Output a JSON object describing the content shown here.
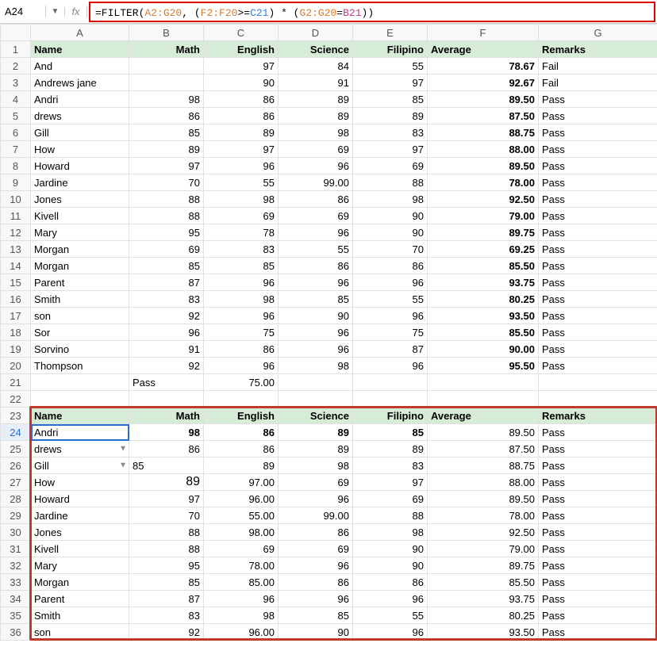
{
  "cellRef": "A24",
  "fx": "fx",
  "formula_parts": {
    "p1": "=FILTER(",
    "range": "A2:G20",
    "p2": ", (",
    "f_range": "F2:F20",
    "p3": ">=",
    "c21": "C21",
    "p4": ") * (",
    "g_range": "G2:G20",
    "p5": "=",
    "b21": "B21",
    "p6": "))"
  },
  "colHeaders": [
    "A",
    "B",
    "C",
    "D",
    "E",
    "F",
    "G"
  ],
  "rowNums": [
    "1",
    "2",
    "3",
    "4",
    "5",
    "6",
    "7",
    "8",
    "9",
    "10",
    "11",
    "12",
    "13",
    "14",
    "15",
    "16",
    "17",
    "18",
    "19",
    "20",
    "21",
    "22",
    "23",
    "24",
    "25",
    "26",
    "27",
    "28",
    "29",
    "30",
    "31",
    "32",
    "33",
    "34",
    "35",
    "36"
  ],
  "headers": {
    "name": "Name",
    "math": "Math",
    "english": "English",
    "science": "Science",
    "filipino": "Filipino",
    "average": "Average",
    "remarks": "Remarks"
  },
  "topRows": [
    {
      "name": "And",
      "math": "",
      "english": "97",
      "science": "84",
      "filipino": "55",
      "avg": "78.67",
      "rem": "Fail"
    },
    {
      "name": "Andrews jane",
      "math": "",
      "english": "90",
      "science": "91",
      "filipino": "97",
      "avg": "92.67",
      "rem": "Fail"
    },
    {
      "name": "Andri",
      "math": "98",
      "english": "86",
      "science": "89",
      "filipino": "85",
      "avg": "89.50",
      "rem": "Pass"
    },
    {
      "name": "drews",
      "math": "86",
      "english": "86",
      "science": "89",
      "filipino": "89",
      "avg": "87.50",
      "rem": "Pass"
    },
    {
      "name": "Gill",
      "math": "85",
      "english": "89",
      "science": "98",
      "filipino": "83",
      "avg": "88.75",
      "rem": "Pass"
    },
    {
      "name": "How",
      "math": "89",
      "english": "97",
      "science": "69",
      "filipino": "97",
      "avg": "88.00",
      "rem": "Pass"
    },
    {
      "name": "Howard",
      "math": "97",
      "english": "96",
      "science": "96",
      "filipino": "69",
      "avg": "89.50",
      "rem": "Pass"
    },
    {
      "name": "Jardine",
      "math": "70",
      "english": "55",
      "science": "99.00",
      "filipino": "88",
      "avg": "78.00",
      "rem": "Pass"
    },
    {
      "name": "Jones",
      "math": "88",
      "english": "98",
      "science": "86",
      "filipino": "98",
      "avg": "92.50",
      "rem": "Pass"
    },
    {
      "name": "Kivell",
      "math": "88",
      "english": "69",
      "science": "69",
      "filipino": "90",
      "avg": "79.00",
      "rem": "Pass"
    },
    {
      "name": "Mary",
      "math": "95",
      "english": "78",
      "science": "96",
      "filipino": "90",
      "avg": "89.75",
      "rem": "Pass"
    },
    {
      "name": "Morgan",
      "math": "69",
      "english": "83",
      "science": "55",
      "filipino": "70",
      "avg": "69.25",
      "rem": "Pass"
    },
    {
      "name": "Morgan",
      "math": "85",
      "english": "85",
      "science": "86",
      "filipino": "86",
      "avg": "85.50",
      "rem": "Pass"
    },
    {
      "name": "Parent",
      "math": "87",
      "english": "96",
      "science": "96",
      "filipino": "96",
      "avg": "93.75",
      "rem": "Pass"
    },
    {
      "name": "Smith",
      "math": "83",
      "english": "98",
      "science": "85",
      "filipino": "55",
      "avg": "80.25",
      "rem": "Pass"
    },
    {
      "name": "son",
      "math": "92",
      "english": "96",
      "science": "90",
      "filipino": "96",
      "avg": "93.50",
      "rem": "Pass"
    },
    {
      "name": "Sor",
      "math": "96",
      "english": "75",
      "science": "96",
      "filipino": "75",
      "avg": "85.50",
      "rem": "Pass"
    },
    {
      "name": "Sorvino",
      "math": "91",
      "english": "86",
      "science": "96",
      "filipino": "87",
      "avg": "90.00",
      "rem": "Pass"
    },
    {
      "name": "Thompson",
      "math": "92",
      "english": "96",
      "science": "98",
      "filipino": "96",
      "avg": "95.50",
      "rem": "Pass"
    }
  ],
  "criteriaRow": {
    "b": "Pass",
    "c": "75.00"
  },
  "bottomRows": [
    {
      "name": "Andri",
      "math": "98",
      "english": "86",
      "science": "89",
      "filipino": "85",
      "avg": "89.50",
      "rem": "Pass",
      "sel": true
    },
    {
      "name": "drews",
      "math": "86",
      "english": "86",
      "science": "89",
      "filipino": "89",
      "avg": "87.50",
      "rem": "Pass",
      "dd": true
    },
    {
      "name": "Gill",
      "math": "85",
      "english": "89",
      "science": "98",
      "filipino": "83",
      "avg": "88.75",
      "rem": "Pass",
      "dd": true,
      "mathLeft": true
    },
    {
      "name": "How",
      "math": "89",
      "english": "97.00",
      "science": "69",
      "filipino": "97",
      "avg": "88.00",
      "rem": "Pass",
      "mathBig": true
    },
    {
      "name": "Howard",
      "math": "97",
      "english": "96.00",
      "science": "96",
      "filipino": "69",
      "avg": "89.50",
      "rem": "Pass"
    },
    {
      "name": "Jardine",
      "math": "70",
      "english": "55.00",
      "science": "99.00",
      "filipino": "88",
      "avg": "78.00",
      "rem": "Pass"
    },
    {
      "name": "Jones",
      "math": "88",
      "english": "98.00",
      "science": "86",
      "filipino": "98",
      "avg": "92.50",
      "rem": "Pass"
    },
    {
      "name": "Kivell",
      "math": "88",
      "english": "69",
      "science": "69",
      "filipino": "90",
      "avg": "79.00",
      "rem": "Pass"
    },
    {
      "name": "Mary",
      "math": "95",
      "english": "78.00",
      "science": "96",
      "filipino": "90",
      "avg": "89.75",
      "rem": "Pass"
    },
    {
      "name": "Morgan",
      "math": "85",
      "english": "85.00",
      "science": "86",
      "filipino": "86",
      "avg": "85.50",
      "rem": "Pass"
    },
    {
      "name": "Parent",
      "math": "87",
      "english": "96",
      "science": "96",
      "filipino": "96",
      "avg": "93.75",
      "rem": "Pass"
    },
    {
      "name": "Smith",
      "math": "83",
      "english": "98",
      "science": "85",
      "filipino": "55",
      "avg": "80.25",
      "rem": "Pass"
    },
    {
      "name": "son",
      "math": "92",
      "english": "96.00",
      "science": "90",
      "filipino": "96",
      "avg": "93.50",
      "rem": "Pass"
    }
  ]
}
